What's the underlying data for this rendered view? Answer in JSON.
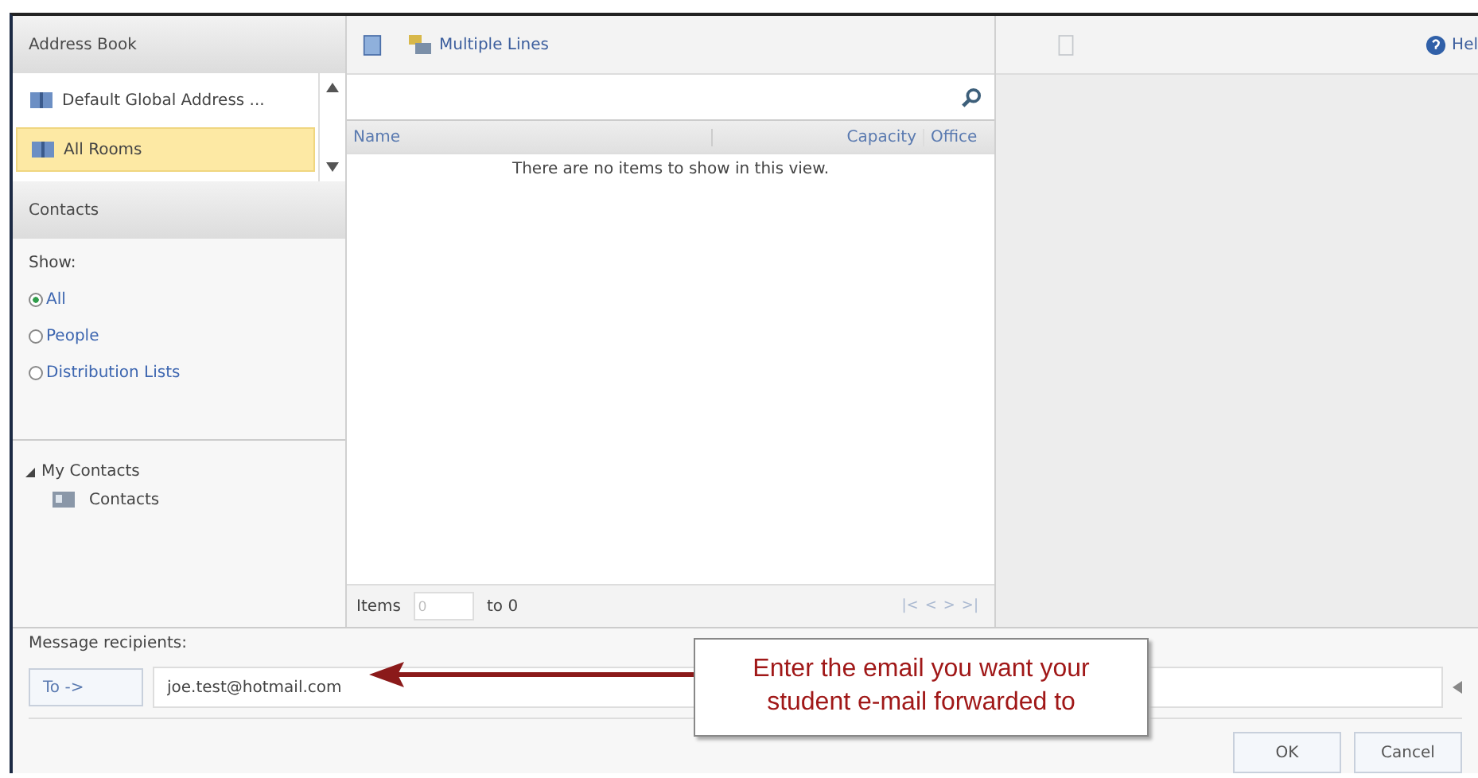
{
  "address_book": {
    "title": "Address Book",
    "lists": [
      {
        "label": "Default Global Address ...",
        "selected": false
      },
      {
        "label": "All Rooms",
        "selected": true
      }
    ]
  },
  "contacts": {
    "title": "Contacts",
    "show_label": "Show:",
    "filters": [
      {
        "label": "All",
        "selected": true
      },
      {
        "label": "People",
        "selected": false
      },
      {
        "label": "Distribution Lists",
        "selected": false
      }
    ],
    "tree": [
      {
        "label": "My Contacts",
        "expanded": true,
        "children": [
          {
            "label": "Contacts"
          }
        ]
      }
    ]
  },
  "toolbar": {
    "view_label": "Multiple Lines"
  },
  "table": {
    "columns": [
      "Name",
      "Capacity",
      "Office"
    ],
    "empty_message": "There are no items to show in this view."
  },
  "pager": {
    "items_label": "Items",
    "from": "0",
    "to_label": "to 0",
    "buttons": [
      "|<",
      "<",
      ">",
      ">|"
    ]
  },
  "help": {
    "label": "Hel"
  },
  "recipients": {
    "label": "Message recipients:",
    "to_button": "To ->",
    "value": "joe.test@hotmail.com"
  },
  "callout": {
    "text": "Enter the email you want your student e-mail forwarded to"
  },
  "buttons": [
    "OK",
    "Cancel"
  ]
}
